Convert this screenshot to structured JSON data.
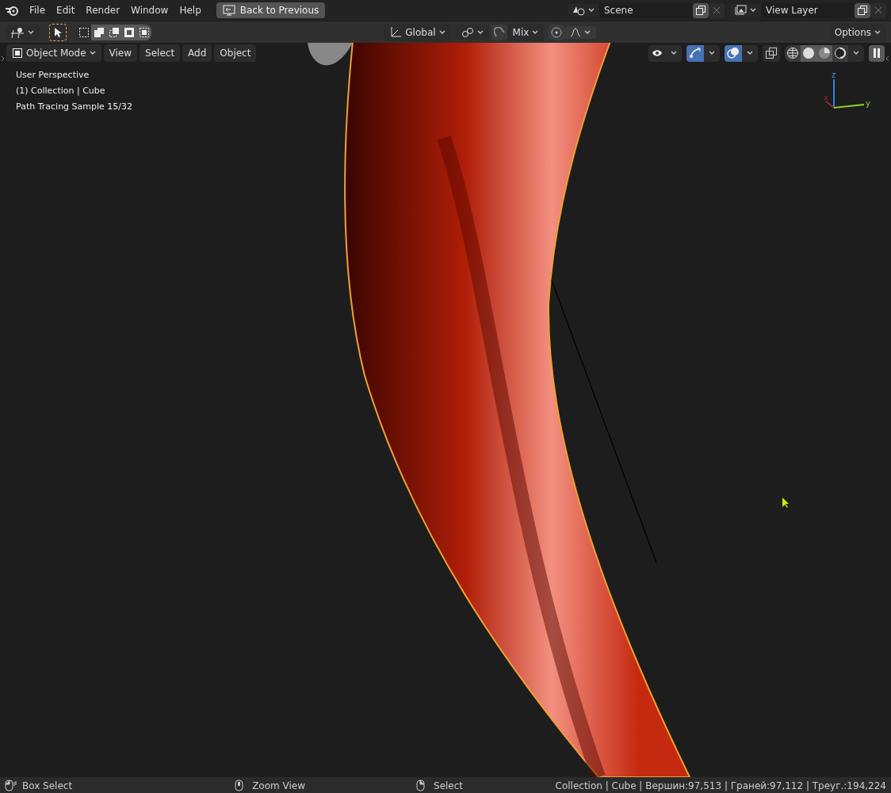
{
  "menu": [
    "File",
    "Edit",
    "Render",
    "Window",
    "Help"
  ],
  "back_button": "Back to Previous",
  "scene": {
    "value": "Scene"
  },
  "view_layer": {
    "value": "View Layer"
  },
  "tool_header": {
    "orientation": "Global",
    "pivot_blend": "Mix",
    "options": "Options"
  },
  "viewport_header": {
    "mode": "Object Mode",
    "menus": [
      "View",
      "Select",
      "Add",
      "Object"
    ],
    "gizmos_on": true,
    "overlays_on": true
  },
  "overlay_text": [
    "User Perspective",
    "(1) Collection | Cube",
    "Path Tracing Sample 15/32"
  ],
  "axes": [
    "z",
    "x",
    "y"
  ],
  "status_bar": {
    "hints": [
      "Box Select",
      "Zoom View",
      "Select"
    ],
    "stats": "Collection | Cube | Вершин:97,513 | Граней:97,112 | Треуг.:194,224"
  }
}
